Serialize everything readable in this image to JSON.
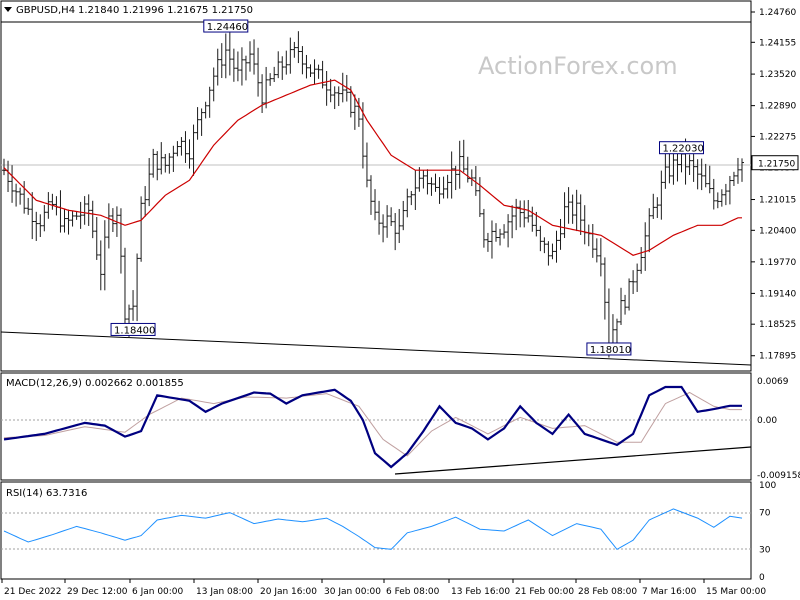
{
  "header": {
    "symbol": "GBPUSD,H4",
    "ohlc": "1.21840 1.21996 1.21675 1.21750"
  },
  "watermark": "ActionForex.com",
  "colors": {
    "bars": "#1a1a1a",
    "ma": "#cc0000",
    "macd": "#000080",
    "signal": "#c0a0a0",
    "trend": "#000000",
    "label_border": "#000080"
  },
  "chart_data": [
    {
      "type": "ohlc",
      "panel": "price",
      "title": "GBPUSD,H4",
      "xlabel": "",
      "ylabel": "",
      "ylim": [
        1.1765,
        1.249
      ],
      "y_ticks": [
        "1.24760",
        "1.24155",
        "1.23520",
        "1.22890",
        "1.22275",
        "1.21650",
        "1.21015",
        "1.20400",
        "1.19770",
        "1.19140",
        "1.18525",
        "1.17895"
      ],
      "current_price": "1.21750",
      "x_ticks": [
        "21 Dec 2022",
        "29 Dec 12:00",
        "6 Jan 00:00",
        "13 Jan 08:00",
        "20 Jan 16:00",
        "30 Jan 00:00",
        "6 Feb 08:00",
        "13 Feb 16:00",
        "21 Feb 00:00",
        "28 Feb 08:00",
        "7 Mar 16:00",
        "15 Mar 00:00"
      ],
      "annotations": [
        {
          "text": "1.24460",
          "x": 55,
          "y": 1.2446
        },
        {
          "text": "1.18400",
          "x": 32,
          "y": 1.184
        },
        {
          "text": "1.18010",
          "x": 150,
          "y": 1.1801
        },
        {
          "text": "1.22030",
          "x": 168,
          "y": 1.2203
        }
      ],
      "close_path": [
        [
          0,
          1.216
        ],
        [
          3,
          1.212
        ],
        [
          6,
          1.208
        ],
        [
          9,
          1.206
        ],
        [
          12,
          1.209
        ],
        [
          15,
          1.205
        ],
        [
          18,
          1.207
        ],
        [
          21,
          1.208
        ],
        [
          24,
          1.196
        ],
        [
          26,
          1.206
        ],
        [
          28,
          1.208
        ],
        [
          30,
          1.188
        ],
        [
          32,
          1.189
        ],
        [
          34,
          1.208
        ],
        [
          37,
          1.218
        ],
        [
          40,
          1.217
        ],
        [
          43,
          1.222
        ],
        [
          46,
          1.22
        ],
        [
          49,
          1.228
        ],
        [
          52,
          1.235
        ],
        [
          55,
          1.24
        ],
        [
          58,
          1.235
        ],
        [
          61,
          1.239
        ],
        [
          64,
          1.231
        ],
        [
          67,
          1.235
        ],
        [
          70,
          1.238
        ],
        [
          73,
          1.24
        ],
        [
          76,
          1.236
        ],
        [
          79,
          1.234
        ],
        [
          82,
          1.232
        ],
        [
          85,
          1.23
        ],
        [
          88,
          1.227
        ],
        [
          90,
          1.213
        ],
        [
          92,
          1.206
        ],
        [
          95,
          1.206
        ],
        [
          98,
          1.204
        ],
        [
          101,
          1.212
        ],
        [
          104,
          1.215
        ],
        [
          107,
          1.212
        ],
        [
          110,
          1.215
        ],
        [
          113,
          1.217
        ],
        [
          116,
          1.214
        ],
        [
          119,
          1.203
        ],
        [
          122,
          1.204
        ],
        [
          124,
          1.205
        ],
        [
          127,
          1.208
        ],
        [
          130,
          1.207
        ],
        [
          133,
          1.201
        ],
        [
          136,
          1.199
        ],
        [
          139,
          1.208
        ],
        [
          142,
          1.208
        ],
        [
          145,
          1.203
        ],
        [
          148,
          1.199
        ],
        [
          150,
          1.182
        ],
        [
          152,
          1.187
        ],
        [
          155,
          1.192
        ],
        [
          158,
          1.2
        ],
        [
          161,
          1.208
        ],
        [
          164,
          1.215
        ],
        [
          167,
          1.218
        ],
        [
          170,
          1.217
        ],
        [
          173,
          1.214
        ],
        [
          176,
          1.21
        ],
        [
          179,
          1.213
        ],
        [
          182,
          1.2175
        ]
      ],
      "ma_path": [
        [
          0,
          1.2165
        ],
        [
          8,
          1.21
        ],
        [
          16,
          1.208
        ],
        [
          24,
          1.207
        ],
        [
          30,
          1.205
        ],
        [
          34,
          1.206
        ],
        [
          40,
          1.211
        ],
        [
          46,
          1.214
        ],
        [
          52,
          1.221
        ],
        [
          58,
          1.226
        ],
        [
          64,
          1.229
        ],
        [
          70,
          1.231
        ],
        [
          76,
          1.233
        ],
        [
          82,
          1.234
        ],
        [
          86,
          1.232
        ],
        [
          90,
          1.226
        ],
        [
          96,
          1.219
        ],
        [
          102,
          1.216
        ],
        [
          108,
          1.216
        ],
        [
          113,
          1.216
        ],
        [
          118,
          1.213
        ],
        [
          124,
          1.209
        ],
        [
          130,
          1.208
        ],
        [
          136,
          1.205
        ],
        [
          142,
          1.204
        ],
        [
          148,
          1.203
        ],
        [
          152,
          1.201
        ],
        [
          156,
          1.199
        ],
        [
          160,
          1.2
        ],
        [
          166,
          1.203
        ],
        [
          172,
          1.205
        ],
        [
          178,
          1.205
        ],
        [
          182,
          1.2065
        ]
      ]
    },
    {
      "type": "line",
      "panel": "macd",
      "title": "MACD(12,26,9) 0.002662 0.001855",
      "ylim": [
        -0.0105,
        0.008
      ],
      "y_ticks": [
        "0.0069",
        "0.00",
        "-0.009158"
      ],
      "series": [
        {
          "name": "MACD",
          "values_path": [
            [
              0,
              -0.0035
            ],
            [
              5,
              -0.003
            ],
            [
              10,
              -0.0025
            ],
            [
              15,
              -0.0015
            ],
            [
              20,
              -0.0005
            ],
            [
              25,
              -0.001
            ],
            [
              30,
              -0.003
            ],
            [
              34,
              -0.002
            ],
            [
              38,
              0.0045
            ],
            [
              42,
              0.004
            ],
            [
              46,
              0.0035
            ],
            [
              50,
              0.0015
            ],
            [
              54,
              0.003
            ],
            [
              58,
              0.004
            ],
            [
              62,
              0.005
            ],
            [
              66,
              0.0048
            ],
            [
              70,
              0.003
            ],
            [
              74,
              0.0045
            ],
            [
              78,
              0.005
            ],
            [
              82,
              0.0055
            ],
            [
              86,
              0.0035
            ],
            [
              89,
              0.0
            ],
            [
              92,
              -0.006
            ],
            [
              96,
              -0.0085
            ],
            [
              100,
              -0.006
            ],
            [
              104,
              -0.002
            ],
            [
              108,
              0.0025
            ],
            [
              112,
              -0.0005
            ],
            [
              116,
              -0.0015
            ],
            [
              120,
              -0.0035
            ],
            [
              124,
              -0.0015
            ],
            [
              128,
              0.0025
            ],
            [
              132,
              -0.0005
            ],
            [
              136,
              -0.0025
            ],
            [
              140,
              0.001
            ],
            [
              144,
              -0.0025
            ],
            [
              148,
              -0.0035
            ],
            [
              152,
              -0.0045
            ],
            [
              156,
              -0.0025
            ],
            [
              160,
              0.0045
            ],
            [
              164,
              0.006
            ],
            [
              168,
              0.006
            ],
            [
              172,
              0.0015
            ],
            [
              176,
              0.002
            ],
            [
              180,
              0.0026
            ]
          ]
        },
        {
          "name": "Signal",
          "values_path": [
            [
              0,
              -0.0032
            ],
            [
              10,
              -0.0028
            ],
            [
              20,
              -0.0012
            ],
            [
              30,
              -0.0022
            ],
            [
              36,
              0.001
            ],
            [
              44,
              0.004
            ],
            [
              52,
              0.003
            ],
            [
              60,
              0.0042
            ],
            [
              70,
              0.004
            ],
            [
              80,
              0.0048
            ],
            [
              88,
              0.0025
            ],
            [
              94,
              -0.0035
            ],
            [
              100,
              -0.0065
            ],
            [
              106,
              -0.002
            ],
            [
              112,
              0.0005
            ],
            [
              120,
              -0.0025
            ],
            [
              128,
              0.0005
            ],
            [
              136,
              -0.0015
            ],
            [
              144,
              -0.001
            ],
            [
              152,
              -0.004
            ],
            [
              158,
              -0.004
            ],
            [
              164,
              0.003
            ],
            [
              170,
              0.005
            ],
            [
              176,
              0.0025
            ],
            [
              180,
              0.0019
            ]
          ]
        }
      ]
    },
    {
      "type": "line",
      "panel": "rsi",
      "title": "RSI(14) 63.7316",
      "ylim": [
        0,
        100
      ],
      "y_ticks": [
        "100",
        "70",
        "30",
        "0"
      ],
      "series": [
        {
          "name": "RSI",
          "values_path": [
            [
              0,
              50
            ],
            [
              6,
              38
            ],
            [
              12,
              46
            ],
            [
              18,
              55
            ],
            [
              24,
              48
            ],
            [
              30,
              40
            ],
            [
              34,
              45
            ],
            [
              38,
              62
            ],
            [
              44,
              67
            ],
            [
              50,
              64
            ],
            [
              56,
              70
            ],
            [
              62,
              58
            ],
            [
              68,
              63
            ],
            [
              74,
              60
            ],
            [
              80,
              64
            ],
            [
              84,
              55
            ],
            [
              88,
              44
            ],
            [
              92,
              32
            ],
            [
              96,
              30
            ],
            [
              100,
              48
            ],
            [
              106,
              55
            ],
            [
              112,
              65
            ],
            [
              118,
              52
            ],
            [
              124,
              50
            ],
            [
              130,
              62
            ],
            [
              136,
              45
            ],
            [
              142,
              58
            ],
            [
              148,
              52
            ],
            [
              152,
              30
            ],
            [
              156,
              40
            ],
            [
              160,
              62
            ],
            [
              166,
              74
            ],
            [
              172,
              64
            ],
            [
              176,
              54
            ],
            [
              180,
              66
            ],
            [
              183,
              64
            ]
          ]
        }
      ]
    }
  ]
}
